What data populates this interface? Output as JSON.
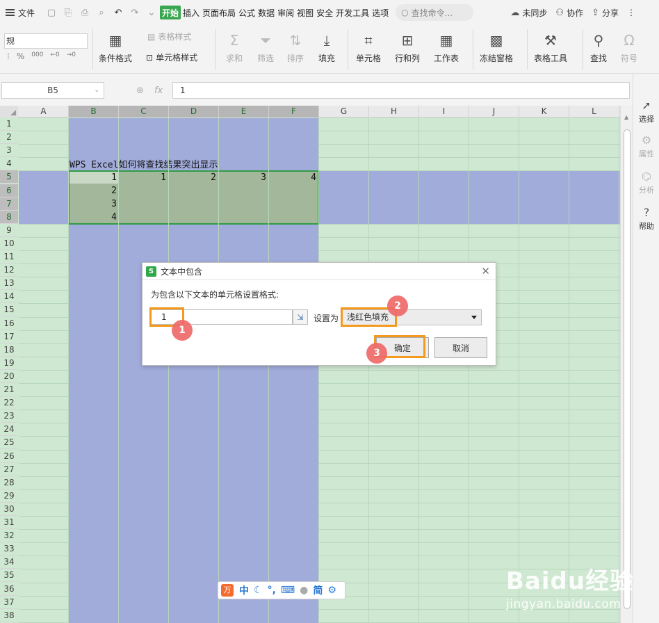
{
  "menu": {
    "file_label": "文件",
    "tabs": [
      "开始",
      "插入",
      "页面布局",
      "公式",
      "数据",
      "审阅",
      "视图",
      "安全",
      "开发工具",
      "选项"
    ],
    "search_placeholder": "查找命令...",
    "sync_label": "未同步",
    "collab_label": "协作",
    "share_label": "分享"
  },
  "ribbon": {
    "font_box": "规",
    "percent": "%",
    "thousands": "000",
    "cond_format": "条件格式",
    "table_style": "表格样式",
    "cell_style": "单元格样式",
    "sum": "求和",
    "filter": "筛选",
    "sort": "排序",
    "fill": "填充",
    "cells": "单元格",
    "rowcol": "行和列",
    "worksheet": "工作表",
    "freeze": "冻结窗格",
    "table_tools": "表格工具",
    "find": "查找",
    "symbol": "符号"
  },
  "formula_bar": {
    "name_box": "B5",
    "fx": "fx",
    "value": "1"
  },
  "sheet": {
    "columns": [
      "A",
      "B",
      "C",
      "D",
      "E",
      "F",
      "G",
      "H",
      "I",
      "J",
      "K",
      "L"
    ],
    "rows": [
      "1",
      "2",
      "3",
      "4",
      "5",
      "6",
      "7",
      "8",
      "9",
      "10",
      "11",
      "12",
      "13",
      "14",
      "15",
      "16",
      "17",
      "18",
      "19",
      "20",
      "21",
      "22",
      "23",
      "24",
      "25",
      "26",
      "27",
      "28",
      "29",
      "30",
      "31",
      "32",
      "33",
      "34",
      "35",
      "36",
      "37",
      "38"
    ],
    "title": "WPS Excel如何将查找结果突出显示",
    "row5": [
      "1",
      "1",
      "2",
      "3",
      "4"
    ],
    "colB": [
      "2",
      "3",
      "4"
    ],
    "colors": {
      "band": "#a2acdb",
      "base": "#cfe8d1",
      "selection": "#a3b89a",
      "selection_border": "#2f9c44"
    }
  },
  "side_pane": {
    "select": "选择",
    "properties": "属性",
    "analysis": "分析",
    "help": "帮助"
  },
  "dialog": {
    "title": "文本中包含",
    "prompt": "为包含以下文本的单元格设置格式:",
    "input_value": "1",
    "set_as": "设置为",
    "format_value": "浅红色填充",
    "ok": "确定",
    "cancel": "取消",
    "steps": [
      "1",
      "2",
      "3"
    ],
    "highlight_color": "#f39a1e",
    "badge_color": "#ef6a6a"
  },
  "ime": {
    "logo": "万",
    "lang": "中",
    "mode": "简"
  },
  "watermark": {
    "brand": "Baidu经验",
    "url": "jingyan.baidu.com"
  }
}
